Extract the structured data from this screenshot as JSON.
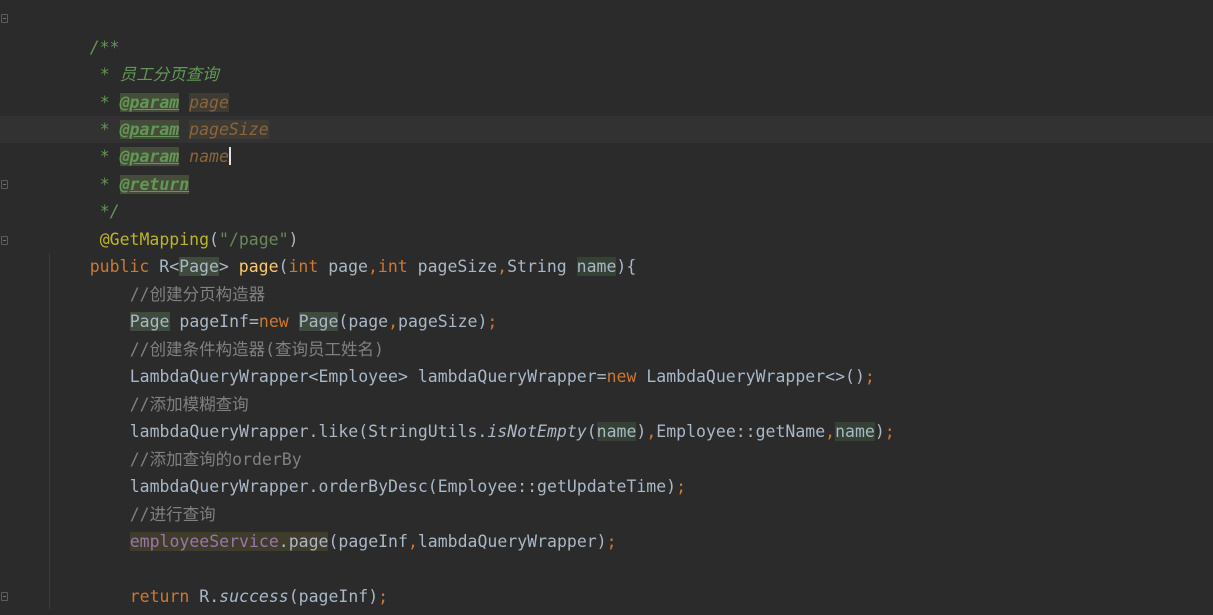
{
  "editor": {
    "lines": {
      "l1": "/**",
      "l2_star": "* ",
      "l2_text": "员工分页查询",
      "l3_star": "* ",
      "l3_tag": "@param",
      "l3_val": "page",
      "l4_star": "* ",
      "l4_tag": "@param",
      "l4_val": "pageSize",
      "l5_star": "* ",
      "l5_tag": "@param",
      "l5_val": "name",
      "l6_star": "* ",
      "l6_tag": "@return",
      "l7": "*/",
      "l8_annotation": "@GetMapping",
      "l8_open": "(",
      "l8_string": "\"/page\"",
      "l8_close": ")",
      "l9_public": "public ",
      "l9_R": "R<",
      "l9_Page": "Page",
      "l9_gt": "> ",
      "l9_method": "page",
      "l9_open": "(",
      "l9_int1": "int ",
      "l9_p1": "page",
      "l9_comma1": ",",
      "l9_int2": "int ",
      "l9_p2": "pageSize",
      "l9_comma2": ",",
      "l9_string": "String ",
      "l9_name": "name",
      "l9_close": "){",
      "l10": "//创建分页构造器",
      "l11_Page": "Page",
      "l11_rest": " pageInf=",
      "l11_new": "new ",
      "l11_Page2": "Page",
      "l11_args": "(page",
      "l11_comma": ",",
      "l11_args2": "pageSize)",
      "l11_semi": ";",
      "l12": "//创建条件构造器(查询员工姓名)",
      "l13_a": "LambdaQueryWrapper<Employee> lambdaQueryWrapper=",
      "l13_new": "new ",
      "l13_b": "LambdaQueryWrapper<>()",
      "l13_semi": ";",
      "l14": "//添加模糊查询",
      "l15_a": "lambdaQueryWrapper.like(StringUtils.",
      "l15_static": "isNotEmpty",
      "l15_open": "(",
      "l15_name1": "name",
      "l15_mid": ")",
      "l15_comma1": ",",
      "l15_ref": "Employee::getName",
      "l15_comma2": ",",
      "l15_name2": "name",
      "l15_close": ")",
      "l15_semi": ";",
      "l16": "//添加查询的orderBy",
      "l17_a": "lambdaQueryWrapper.orderByDesc(Employee::getUpdateTime)",
      "l17_semi": ";",
      "l18": "//进行查询",
      "l19_service": "employeeService",
      "l19_dot": ".",
      "l19_page": "page",
      "l19_args1": "(pageInf",
      "l19_comma": ",",
      "l19_args2": "lambdaQueryWrapper)",
      "l19_semi": ";",
      "l21_return": "return ",
      "l21_R": "R.",
      "l21_success": "success",
      "l21_args": "(pageInf)",
      "l21_semi": ";",
      "l22": "}"
    }
  }
}
